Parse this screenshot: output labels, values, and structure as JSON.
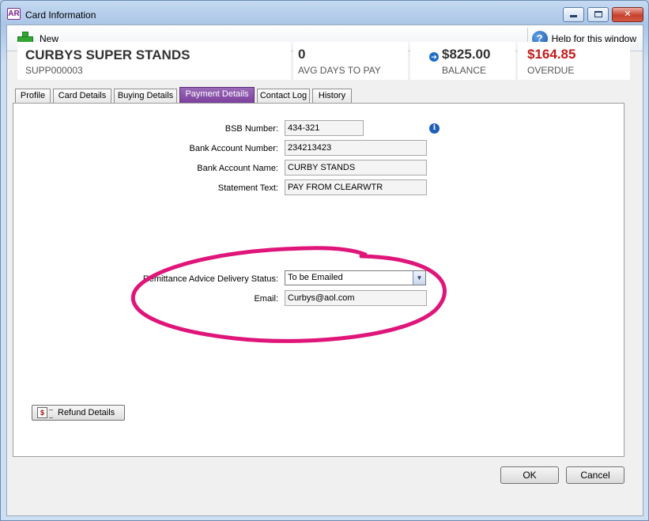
{
  "window": {
    "app_icon": "AR",
    "title": "Card Information"
  },
  "toolbar": {
    "new_label": "New",
    "help_label": "Help for this window"
  },
  "summary": {
    "company_name": "CURBYS SUPER STANDS",
    "card_id": "SUPP000003",
    "avg_days_value": "0",
    "avg_days_label": "AVG DAYS TO PAY",
    "balance_value": "$825.00",
    "balance_label": "BALANCE",
    "overdue_value": "$164.85",
    "overdue_label": "OVERDUE"
  },
  "tabs": [
    {
      "label": "Profile"
    },
    {
      "label": "Card Details"
    },
    {
      "label": "Buying Details"
    },
    {
      "label": "Payment Details",
      "active": true
    },
    {
      "label": "Contact Log"
    },
    {
      "label": "History"
    }
  ],
  "payment": {
    "bsb_label": "BSB Number:",
    "bsb_value": "434-321",
    "account_number_label": "Bank Account Number:",
    "account_number_value": "234213423",
    "account_name_label": "Bank Account Name:",
    "account_name_value": "CURBY STANDS",
    "statement_label": "Statement Text:",
    "statement_value": "PAY FROM CLEARWTR",
    "remittance_label": "Remittance Advice Delivery Status:",
    "remittance_value": "To be Emailed",
    "email_label": "Email:",
    "email_value": "Curbys@aol.com",
    "refund_label": "Refund Details"
  },
  "footer": {
    "ok_label": "OK",
    "cancel_label": "Cancel"
  },
  "colors": {
    "active_tab": "#7a3f9c",
    "overdue": "#c41a1a",
    "highlight_circle": "#e0157a"
  }
}
